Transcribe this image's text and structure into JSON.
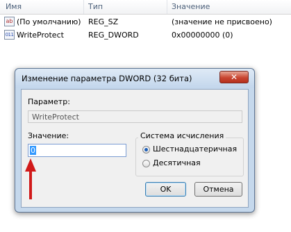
{
  "list": {
    "columns": [
      "Имя",
      "Тип",
      "Значение"
    ],
    "rows": [
      {
        "icon": "string-value-icon",
        "glyph": "ab",
        "name": "(По умолчанию)",
        "type": "REG_SZ",
        "value": "(значение не присвоено)"
      },
      {
        "icon": "dword-value-icon",
        "glyph": "011",
        "name": "WriteProtect",
        "type": "REG_DWORD",
        "value": "0x00000000 (0)"
      }
    ]
  },
  "dialog": {
    "title": "Изменение параметра DWORD (32 бита)",
    "close_glyph": "✕",
    "param_label": "Параметр:",
    "param_name": "WriteProtect",
    "value_label": "Значение:",
    "value": "0",
    "base_group_label": "Система исчисления",
    "base_options": [
      {
        "label": "Шестнадцатеричная",
        "selected": true
      },
      {
        "label": "Десятичная",
        "selected": false
      }
    ],
    "ok_label": "OK",
    "cancel_label": "Отмена"
  },
  "colors": {
    "accent_arrow": "#d11a1a",
    "selection": "#3399ff",
    "header_text": "#4c607a"
  }
}
